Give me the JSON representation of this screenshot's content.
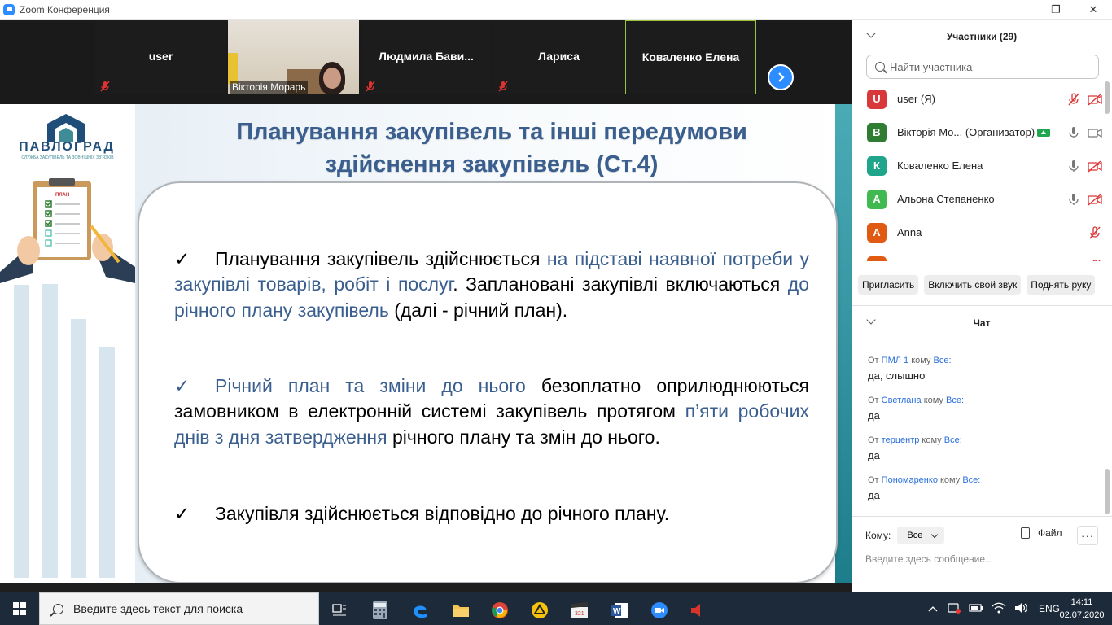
{
  "window": {
    "title": "Zoom Конференция",
    "controls": [
      "—",
      "❐",
      "✕"
    ]
  },
  "video_strip": {
    "tiles": [
      {
        "name": "user",
        "muted": true
      },
      {
        "name": "Вікторія Морарь",
        "video": true
      },
      {
        "name": "Людмила  Бави...",
        "muted": true
      },
      {
        "name": "Лариса",
        "muted": true
      },
      {
        "name": "Коваленко Елена",
        "active_speaker": true
      }
    ],
    "next_icon": "chevron-right-icon"
  },
  "slide": {
    "logo_text": "ПАВЛОГРАД",
    "logo_subtext": "СЛУЖБА ЗАКУПІВЕЛЬ ТА ЗОВНІШНІХ ЗВ'ЯЗКІВ",
    "clipboard_label": "ПЛАН",
    "title_line1": "Планування закупівель та інші передумови",
    "title_line2": "здійснення закупівель (Ст.4)",
    "p1": {
      "check": "✓",
      "t1": "Планування закупівель здійснюється ",
      "h1": "на підставі наявної потреби у закупівлі товарів, робіт і послуг",
      "t2": ". Заплановані закупівлі включаються ",
      "h2": "до річного плану закупівель",
      "t3": " (далі - річний план)."
    },
    "p2": {
      "check": "✓",
      "h1": "Річний план та зміни до нього",
      "t1": " безоплатно оприлюднюються замовником в електронній системі закупівель протягом ",
      "h2": "п’яти робочих днів з дня затвердження",
      "t2": " річного плану та змін до нього."
    },
    "p3": {
      "check": "✓",
      "t1": "Закупівля здійснюється відповідно до річного плану."
    }
  },
  "participants": {
    "header": "Участники (29)",
    "search_placeholder": "Найти участника",
    "list": [
      {
        "initial": "U",
        "color": "#d9383a",
        "name": "user (Я)",
        "mic": "muted",
        "video": "off"
      },
      {
        "initial": "В",
        "color": "#2e7d32",
        "name": "Вікторія Мо...  (Организатор)",
        "badge": true,
        "mic": "on",
        "video": "on"
      },
      {
        "initial": "К",
        "color": "#1fa58a",
        "name": "Коваленко Елена",
        "mic": "on",
        "video": "off"
      },
      {
        "initial": "А",
        "color": "#3fb950",
        "name": "Альона Степаненко",
        "mic": "on",
        "video": "off"
      },
      {
        "initial": "A",
        "color": "#e05a12",
        "name": "Anna",
        "mic": "muted",
        "video": "none"
      },
      {
        "initial": "",
        "color": "#e05a12",
        "name": "",
        "mic": "muted",
        "video": "none"
      }
    ],
    "buttons": [
      "Пригласить",
      "Включить свой звук",
      "Поднять руку"
    ]
  },
  "chat": {
    "header": "Чат",
    "messages": [
      {
        "from": "ПМЛ 1",
        "to": "Все:",
        "text": "да, слышно"
      },
      {
        "from": "Светлана",
        "to": "Все:",
        "text": "да"
      },
      {
        "from": "терцентр",
        "to": "Все:",
        "text": "да"
      },
      {
        "from": "Пономаренко",
        "to": "Все:",
        "text": "да"
      }
    ],
    "from_word": "От",
    "to_word": "кому",
    "to_label": "Кому:",
    "to_value": "Все",
    "file_label": "Файл",
    "more_label": "···",
    "input_placeholder": "Введите здесь сообщение..."
  },
  "taskbar": {
    "search_placeholder": "Введите здесь текст для поиска",
    "lang": "ENG",
    "time": "14:11",
    "date": "02.07.2020"
  }
}
